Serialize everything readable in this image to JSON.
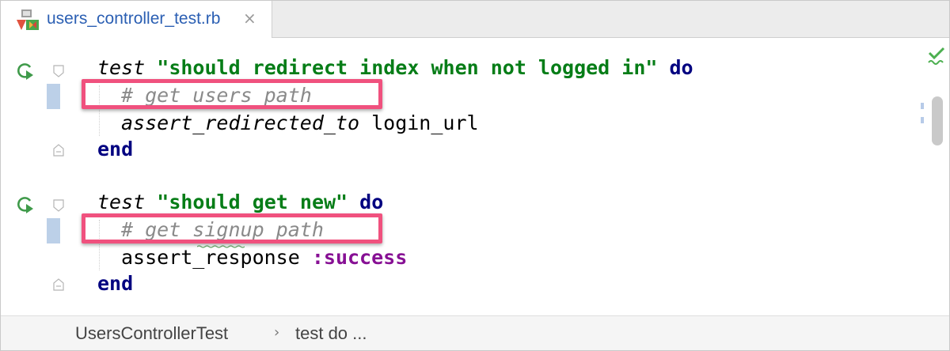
{
  "tab": {
    "title": "users_controller_test.rb",
    "close_symbol": "×",
    "icon": "ruby-file-icon"
  },
  "code": {
    "block1": {
      "method": "test",
      "string": "\"should redirect index when not logged in\"",
      "do": "do",
      "comment": "# get users_path",
      "assert_method": "assert_redirected_to",
      "assert_arg": "login_url",
      "end": "end"
    },
    "block2": {
      "method": "test",
      "string": "\"should get new\"",
      "do": "do",
      "comment": "# get signup_path",
      "assert_method": "assert_response",
      "assert_arg": ":success",
      "end": "end"
    }
  },
  "breadcrumb": {
    "items": [
      "UsersControllerTest",
      "test do ..."
    ],
    "separator": "›"
  },
  "colors": {
    "highlight": "#f0517e",
    "keyword": "#000080",
    "string": "#067d17",
    "comment": "#8a8a8a",
    "symbol": "#871094",
    "file_name": "#2b5fb3"
  }
}
